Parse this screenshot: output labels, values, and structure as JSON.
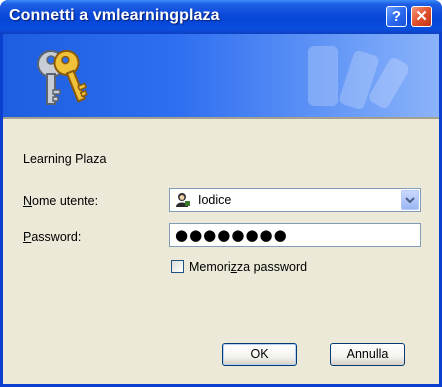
{
  "window": {
    "title": "Connetti a vmlearningplaza",
    "help_button": "?",
    "close_button": "✕"
  },
  "form": {
    "site_label": "Learning Plaza",
    "username_label_accel": "N",
    "username_label_rest": "ome utente:",
    "username_value": "Iodice",
    "password_label_accel": "P",
    "password_label_rest": "assword:",
    "password_masked": "●●●●●●●●",
    "remember_label_pre": "Memori",
    "remember_label_accel": "z",
    "remember_label_post": "za password",
    "remember_checked": false
  },
  "buttons": {
    "ok": "OK",
    "cancel": "Annulla"
  },
  "colors": {
    "titlebar": "#0a49d8",
    "client": "#ece9d8",
    "banner": "#2e6ef0"
  },
  "icons": {
    "banner": "keys-icon",
    "user": "user-icon",
    "dropdown": "chevron-down-icon"
  }
}
